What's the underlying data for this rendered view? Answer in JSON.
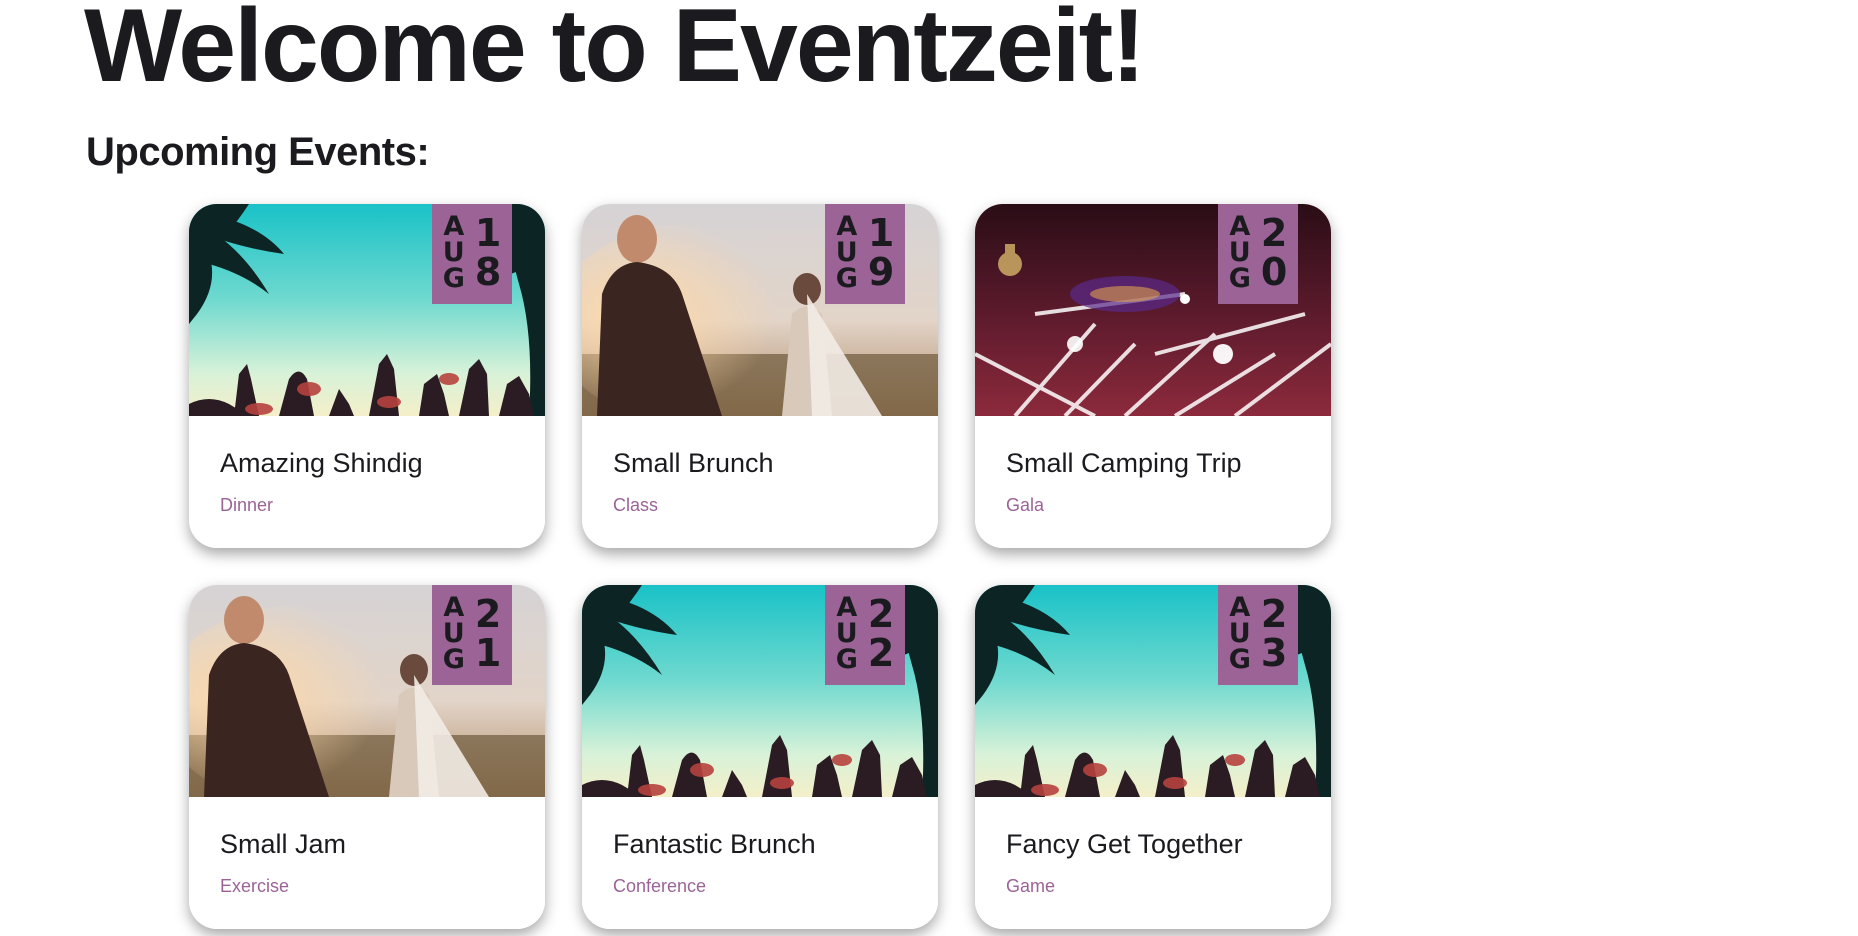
{
  "header": {
    "title": "Welcome to Eventzeit!",
    "subtitle": "Upcoming Events:"
  },
  "colors": {
    "accent": "#9b6396",
    "text": "#1b1b1f",
    "background": "#ffffff"
  },
  "events": [
    {
      "title": "Amazing Shindig",
      "category": "Dinner",
      "month": "AUG",
      "day": "18",
      "image": "beach-party-image",
      "month_letters": [
        "A",
        "U",
        "G"
      ],
      "day_digits": [
        "1",
        "8"
      ]
    },
    {
      "title": "Small Brunch",
      "category": "Class",
      "month": "AUG",
      "day": "19",
      "image": "wedding-couple-image",
      "month_letters": [
        "A",
        "U",
        "G"
      ],
      "day_digits": [
        "1",
        "9"
      ]
    },
    {
      "title": "Small Camping Trip",
      "category": "Gala",
      "month": "AUG",
      "day": "20",
      "image": "concert-lights-image",
      "month_letters": [
        "A",
        "U",
        "G"
      ],
      "day_digits": [
        "2",
        "0"
      ]
    },
    {
      "title": "Small Jam",
      "category": "Exercise",
      "month": "AUG",
      "day": "21",
      "image": "wedding-couple-image",
      "month_letters": [
        "A",
        "U",
        "G"
      ],
      "day_digits": [
        "2",
        "1"
      ]
    },
    {
      "title": "Fantastic Brunch",
      "category": "Conference",
      "month": "AUG",
      "day": "22",
      "image": "beach-party-image",
      "month_letters": [
        "A",
        "U",
        "G"
      ],
      "day_digits": [
        "2",
        "2"
      ]
    },
    {
      "title": "Fancy Get Together",
      "category": "Game",
      "month": "AUG",
      "day": "23",
      "image": "beach-party-image",
      "month_letters": [
        "A",
        "U",
        "G"
      ],
      "day_digits": [
        "2",
        "3"
      ]
    }
  ]
}
